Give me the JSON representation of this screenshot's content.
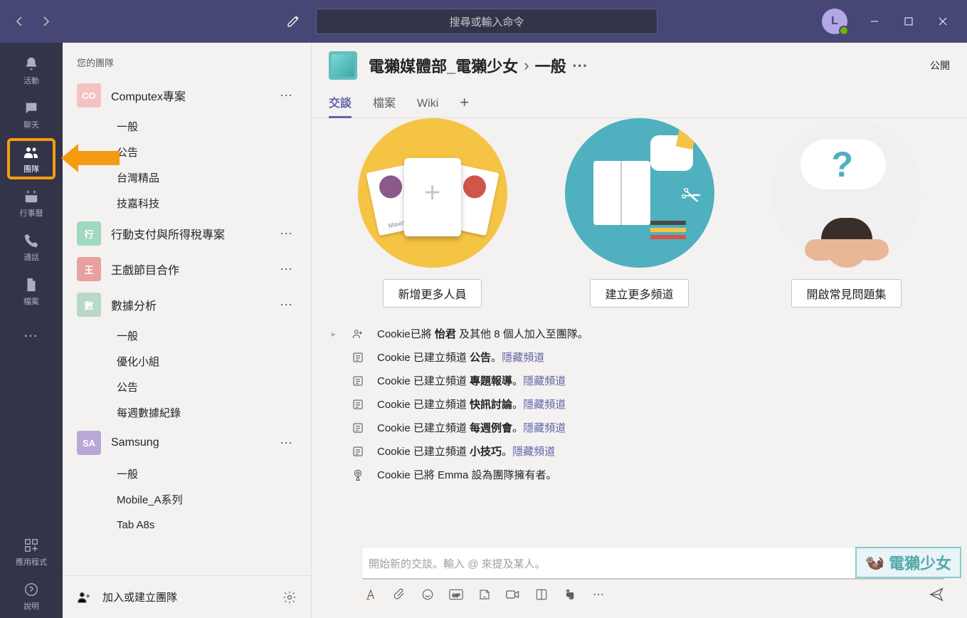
{
  "titlebar": {
    "search_placeholder": "搜尋或輸入命令",
    "avatar_initial": "L"
  },
  "rail": [
    {
      "id": "activity",
      "label": "活動"
    },
    {
      "id": "chat",
      "label": "聊天"
    },
    {
      "id": "teams",
      "label": "團隊"
    },
    {
      "id": "calendar",
      "label": "行事曆"
    },
    {
      "id": "calls",
      "label": "通話"
    },
    {
      "id": "files",
      "label": "檔案"
    }
  ],
  "rail_more": "⋯",
  "rail_apps_label": "應用程式",
  "rail_help_label": "說明",
  "sidebar": {
    "header": "您的團隊",
    "teams": [
      {
        "initials": "CO",
        "color": "#f4c2c2",
        "name": "Computex專案",
        "channels": [
          "一般",
          "公告",
          "台灣精品",
          "技嘉科技"
        ]
      },
      {
        "initials": "行",
        "color": "#a0d8c0",
        "name": "行動支付與所得稅專案",
        "channels": []
      },
      {
        "initials": "王",
        "color": "#e8a0a0",
        "name": "王戲節目合作",
        "channels": []
      },
      {
        "initials": "數",
        "color": "#b8d8c8",
        "name": "數據分析",
        "channels": [
          "一般",
          "優化小組",
          "公告",
          "每週數據紀錄"
        ]
      },
      {
        "initials": "SA",
        "color": "#b8a8d8",
        "name": "Samsung",
        "channels": [
          "一般",
          "Mobile_A系列",
          "Tab A8s"
        ]
      }
    ],
    "join_create": "加入或建立團隊"
  },
  "header": {
    "team": "電獺媒體部_電獺少女",
    "channel": "一般",
    "visibility": "公開"
  },
  "tabs": [
    "交談",
    "檔案",
    "Wiki"
  ],
  "cards": [
    {
      "button": "新增更多人員"
    },
    {
      "button": "建立更多頻道"
    },
    {
      "button": "開啟常見問題集"
    }
  ],
  "events": [
    {
      "icon": "add-user",
      "parts": [
        "Cookie已將 ",
        "怡君",
        " 及其他 8 個人加入至團隊。"
      ],
      "link": ""
    },
    {
      "icon": "channel",
      "parts": [
        "Cookie 已建立頻道 ",
        "公告",
        "。"
      ],
      "link": "隱藏頻道"
    },
    {
      "icon": "channel",
      "parts": [
        "Cookie 已建立頻道 ",
        "專題報導",
        "。"
      ],
      "link": "隱藏頻道"
    },
    {
      "icon": "channel",
      "parts": [
        "Cookie 已建立頻道 ",
        "快訊討論",
        "。"
      ],
      "link": "隱藏頻道"
    },
    {
      "icon": "channel",
      "parts": [
        "Cookie 已建立頻道 ",
        "每週例會",
        "。"
      ],
      "link": "隱藏頻道"
    },
    {
      "icon": "channel",
      "parts": [
        "Cookie 已建立頻道 ",
        "小技巧",
        "。"
      ],
      "link": "隱藏頻道"
    },
    {
      "icon": "owner",
      "parts": [
        "Cookie 已將 Emma 設為團隊擁有者。"
      ],
      "link": ""
    }
  ],
  "compose": {
    "placeholder": "開始新的交談。輸入 @ 來提及某人。"
  },
  "watermark": "電獺少女"
}
